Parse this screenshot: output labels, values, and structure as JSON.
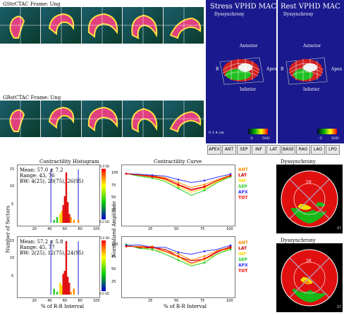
{
  "top_left": {
    "stress_label": "GStrCTAC  Frame: Ung",
    "rest_label": "GRstCTAC  Frame: Ung"
  },
  "panels": {
    "stress_title": "Stress VPHD MAC",
    "rest_title": "Rest VPHD MAC",
    "dyssynchrony": "Dyssynchrony",
    "anterior": "Anterior",
    "inferior": "Inferior",
    "apex": "Apex",
    "septal": "Septal",
    "base_label": "B",
    "scale_left": "0  2  4 cm",
    "scale_neg": "-5",
    "scale_sd": "5SD"
  },
  "buttons": [
    "APEX",
    "ANT",
    "SEP",
    "INF",
    "LAT",
    "BASE",
    "RAO",
    "LAO",
    "LPO"
  ],
  "histogram": {
    "title": "Contractility Histogram",
    "ylabel": "Number of Sectors",
    "xlabel": "% of R-R Interval",
    "stress_mean": "Mean: 57.0 ± 7.2",
    "stress_range": "Range: 43, 76",
    "stress_bw": "BW: 4(25), 20(75), 26(95)",
    "rest_mean": "Mean: 57.2 ± 5.8",
    "rest_range": "Range: 45, 77",
    "rest_bw": "BW: 2(25), 12(75), 24(95)",
    "sd_pos": "5.0 SD",
    "sd_neg": "-5.0 SD",
    "yticks": [
      "15",
      "10",
      "5"
    ],
    "xticks": [
      "20",
      "40",
      "60",
      "80",
      "100"
    ]
  },
  "curve": {
    "title": "Contractility Curve",
    "ylabel": "Normalized Amplitude",
    "xlabel": "% of R-R Interval",
    "yticks": [
      "100",
      "75",
      "50",
      "25"
    ],
    "xticks": [
      "25",
      "50",
      "75",
      "100"
    ],
    "legend": [
      {
        "name": "ANT",
        "color": "#ff8c00"
      },
      {
        "name": "LAT",
        "color": "#cc0000"
      },
      {
        "name": "INF",
        "color": "#ffd700"
      },
      {
        "name": "SEP",
        "color": "#22cc22"
      },
      {
        "name": "APX",
        "color": "#3333ff"
      },
      {
        "name": "TOT",
        "color": "#ff0000"
      }
    ]
  },
  "dyssynchrony": {
    "title": "Dyssynchrony",
    "stress_top": "59",
    "stress_bottom": "57",
    "rest_top": "38",
    "rest_bottom": "57"
  },
  "chart_data": [
    {
      "type": "bar",
      "title": "Contractility Histogram",
      "xlabel": "% of R-R Interval",
      "ylabel": "Number of Sectors",
      "x": [
        44,
        48,
        52,
        54,
        56,
        58,
        60,
        62,
        64,
        66,
        70,
        76
      ],
      "values": [
        1,
        2,
        3,
        4,
        6,
        9,
        17,
        7,
        3,
        2,
        1,
        1
      ],
      "xlim": [
        0,
        100
      ],
      "ylim": [
        0,
        18
      ]
    },
    {
      "type": "line",
      "title": "Contractility Curve",
      "xlabel": "% of R-R Interval",
      "ylabel": "Normalized Amplitude",
      "x": [
        0,
        12.5,
        25,
        37.5,
        50,
        62.5,
        75,
        87.5,
        100
      ],
      "xlim": [
        0,
        100
      ],
      "ylim": [
        0,
        100
      ],
      "series": [
        {
          "name": "ANT",
          "values": [
            100,
            98,
            96,
            92,
            82,
            72,
            78,
            88,
            97
          ]
        },
        {
          "name": "LAT",
          "values": [
            100,
            97,
            95,
            90,
            78,
            68,
            74,
            86,
            96
          ]
        },
        {
          "name": "INF",
          "values": [
            100,
            96,
            93,
            87,
            74,
            62,
            70,
            84,
            95
          ]
        },
        {
          "name": "SEP",
          "values": [
            100,
            95,
            91,
            84,
            70,
            56,
            66,
            82,
            94
          ]
        },
        {
          "name": "APX",
          "values": [
            100,
            99,
            97,
            95,
            88,
            82,
            86,
            93,
            99
          ]
        },
        {
          "name": "TOT",
          "values": [
            100,
            97,
            94,
            89,
            77,
            66,
            73,
            86,
            96
          ]
        }
      ]
    }
  ]
}
